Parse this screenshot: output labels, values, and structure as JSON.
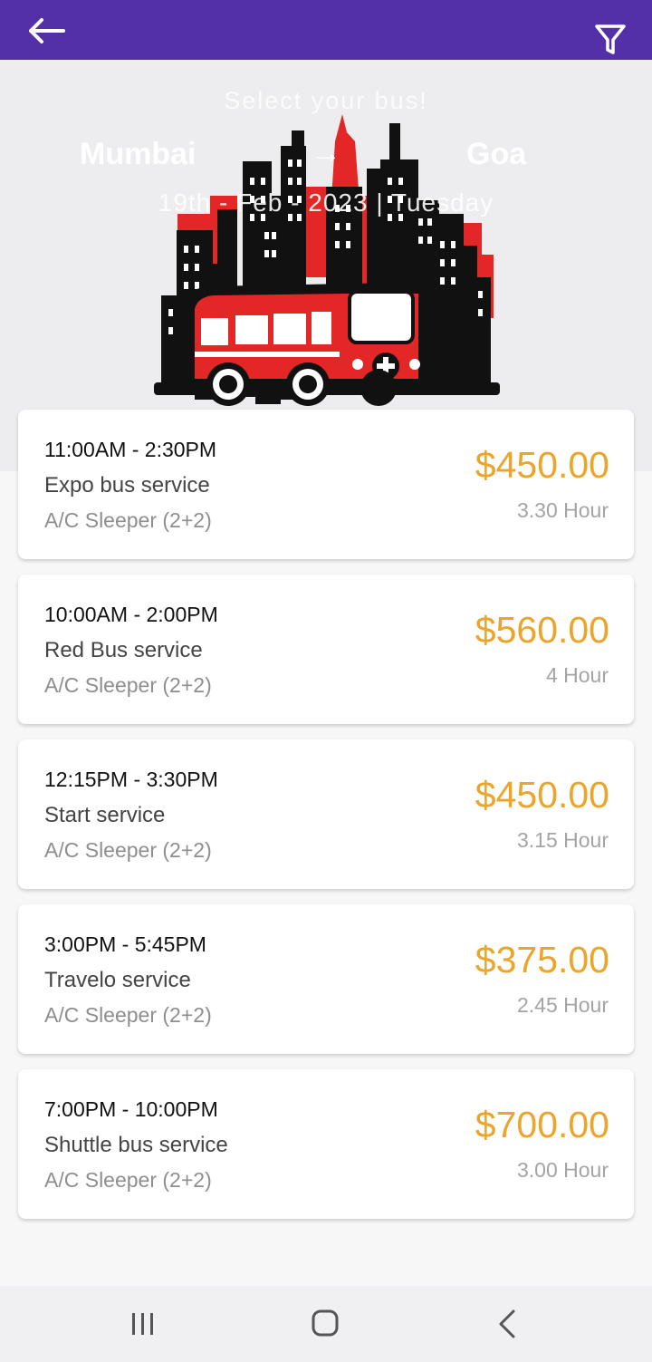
{
  "colors": {
    "appbar": "#5330a8",
    "price": "#eba52b",
    "accent_red": "#e32626"
  },
  "appbar": {
    "back_icon": "arrow-left-icon",
    "filter_icon": "filter-icon"
  },
  "header": {
    "subtitle": "Select your bus!",
    "from": "Mumbai",
    "to": "Goa",
    "route_arrow": "→",
    "date": "19th - Feb - 2023 | Tuesday"
  },
  "buses": [
    {
      "time": "11:00AM - 2:30PM",
      "name": "Expo bus service",
      "type": "A/C Sleeper (2+2)",
      "price": "$450.00",
      "duration": "3.30 Hour"
    },
    {
      "time": "10:00AM - 2:00PM",
      "name": "Red Bus service",
      "type": "A/C Sleeper (2+2)",
      "price": "$560.00",
      "duration": "4 Hour"
    },
    {
      "time": "12:15PM - 3:30PM",
      "name": "Start service",
      "type": "A/C Sleeper (2+2)",
      "price": "$450.00",
      "duration": "3.15 Hour"
    },
    {
      "time": "3:00PM - 5:45PM",
      "name": "Travelo service",
      "type": "A/C Sleeper (2+2)",
      "price": "$375.00",
      "duration": "2.45 Hour"
    },
    {
      "time": "7:00PM - 10:00PM",
      "name": "Shuttle bus service",
      "type": "A/C Sleeper (2+2)",
      "price": "$700.00",
      "duration": "3.00 Hour"
    }
  ],
  "system_nav": {
    "recents_icon": "recents-icon",
    "home_icon": "home-icon",
    "back_icon": "back-chevron-icon"
  }
}
